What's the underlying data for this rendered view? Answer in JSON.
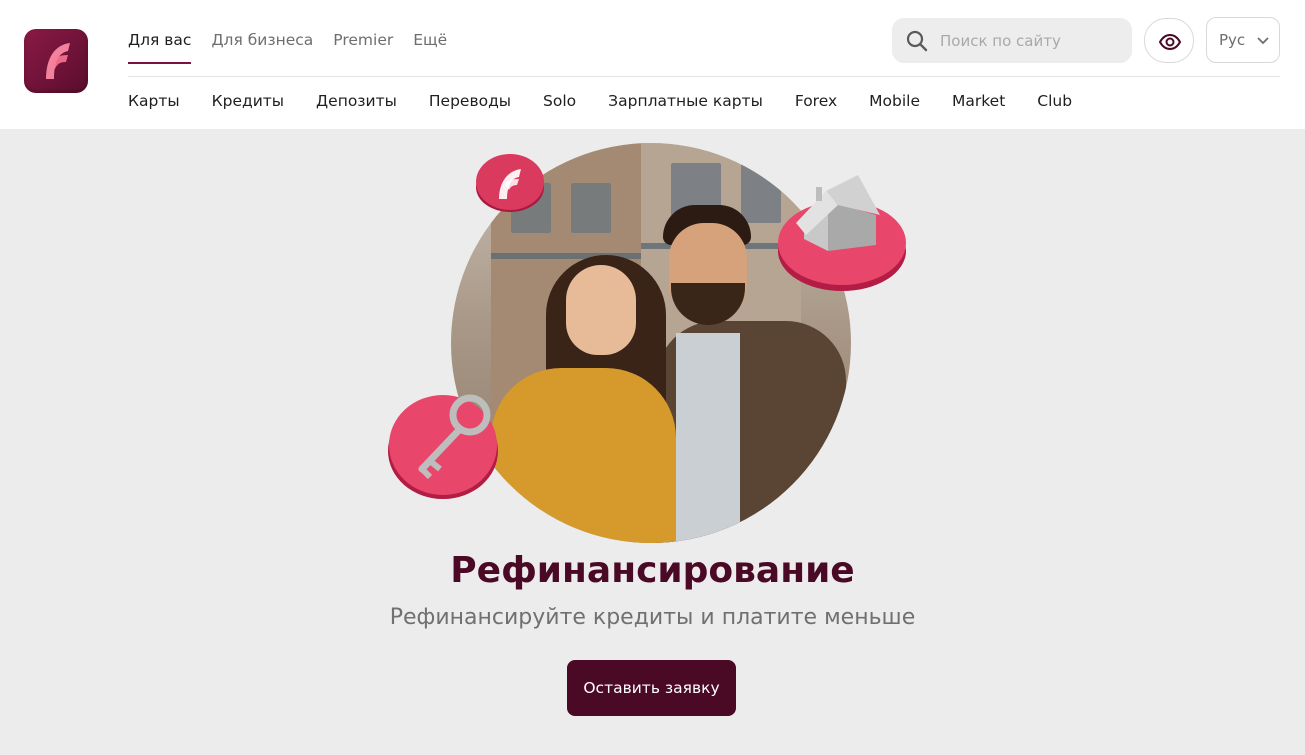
{
  "header": {
    "logo": {
      "icon": "f-logo-icon",
      "color": "#6b1236"
    },
    "segments": [
      {
        "label": "Для вас",
        "active": true
      },
      {
        "label": "Для бизнеса",
        "active": false
      },
      {
        "label": "Premier",
        "active": false
      },
      {
        "label": "Ещё",
        "active": false
      }
    ],
    "search": {
      "placeholder": "Поиск по сайту",
      "icon": "search-icon"
    },
    "accessibility_icon": "eye-icon",
    "language": {
      "label": "Рус",
      "icon": "chevron-down-icon"
    },
    "subnav": [
      "Карты",
      "Кредиты",
      "Депозиты",
      "Переводы",
      "Solo",
      "Зарплатные карты",
      "Forex",
      "Mobile",
      "Market",
      "Club"
    ]
  },
  "hero": {
    "title": "Рефинансирование",
    "subtitle": "Рефинансируйте кредиты и платите меньше",
    "cta_label": "Оставить заявку",
    "accent_color": "#4a0a26",
    "badge_color": "#e5456a"
  }
}
